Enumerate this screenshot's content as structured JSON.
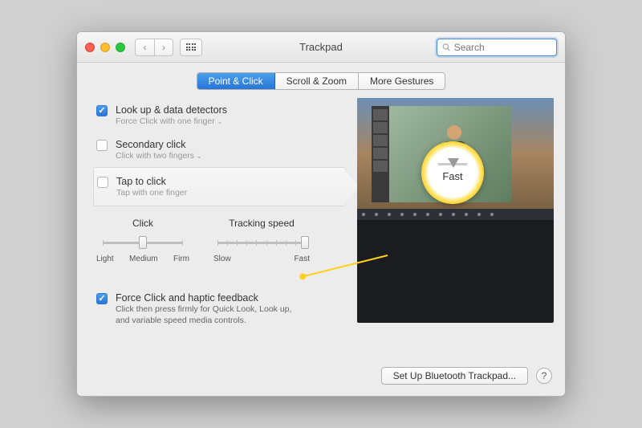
{
  "window": {
    "title": "Trackpad"
  },
  "search": {
    "placeholder": "Search"
  },
  "tabs": [
    {
      "label": "Point & Click",
      "active": true
    },
    {
      "label": "Scroll & Zoom",
      "active": false
    },
    {
      "label": "More Gestures",
      "active": false
    }
  ],
  "options": {
    "lookup": {
      "label": "Look up & data detectors",
      "sub": "Force Click with one finger",
      "checked": true
    },
    "secondary": {
      "label": "Secondary click",
      "sub": "Click with two fingers",
      "checked": false
    },
    "tap": {
      "label": "Tap to click",
      "sub": "Tap with one finger",
      "checked": false
    },
    "forceclick": {
      "label": "Force Click and haptic feedback",
      "desc": "Click then press firmly for Quick Look, Look up, and variable speed media controls.",
      "checked": true
    }
  },
  "sliders": {
    "click": {
      "title": "Click",
      "labels": [
        "Light",
        "Medium",
        "Firm"
      ],
      "value": 1,
      "max": 2
    },
    "tracking": {
      "title": "Tracking speed",
      "labels": [
        "Slow",
        "Fast"
      ],
      "value": 9,
      "max": 9
    }
  },
  "callout": {
    "label": "Fast"
  },
  "footer": {
    "bluetooth": "Set Up Bluetooth Trackpad...",
    "help": "?"
  }
}
